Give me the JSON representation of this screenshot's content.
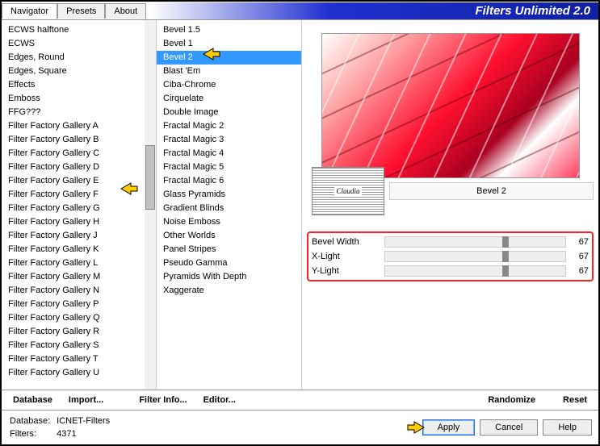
{
  "title": "Filters Unlimited 2.0",
  "tabs": [
    {
      "label": "Navigator",
      "active": true
    },
    {
      "label": "Presets",
      "active": false
    },
    {
      "label": "About",
      "active": false
    }
  ],
  "categories": [
    "ECWS halftone",
    "ECWS",
    "Edges, Round",
    "Edges, Square",
    "Effects",
    "Emboss",
    "FFG???",
    "Filter Factory Gallery A",
    "Filter Factory Gallery B",
    "Filter Factory Gallery C",
    "Filter Factory Gallery D",
    "Filter Factory Gallery E",
    "Filter Factory Gallery F",
    "Filter Factory Gallery G",
    "Filter Factory Gallery H",
    "Filter Factory Gallery J",
    "Filter Factory Gallery K",
    "Filter Factory Gallery L",
    "Filter Factory Gallery M",
    "Filter Factory Gallery N",
    "Filter Factory Gallery P",
    "Filter Factory Gallery Q",
    "Filter Factory Gallery R",
    "Filter Factory Gallery S",
    "Filter Factory Gallery T",
    "Filter Factory Gallery U"
  ],
  "categories_highlight_index": 13,
  "filters": [
    "Bevel 1.5",
    "Bevel 1",
    "Bevel 2",
    "Blast 'Em",
    "Ciba-Chrome",
    "Cirquelate",
    "Double Image",
    "Fractal Magic 2",
    "Fractal Magic 3",
    "Fractal Magic 4",
    "Fractal Magic 5",
    "Fractal Magic 6",
    "Glass Pyramids",
    "Gradient Blinds",
    "Noise Emboss",
    "Other Worlds",
    "Panel Stripes",
    "Pseudo Gamma",
    "Pyramids With Depth",
    "Xaggerate"
  ],
  "filters_selected_index": 2,
  "section_title": "Bevel 2",
  "badge_text": "Claudia",
  "params": [
    {
      "label": "Bevel Width",
      "value": "67"
    },
    {
      "label": "X-Light",
      "value": "67"
    },
    {
      "label": "Y-Light",
      "value": "67"
    }
  ],
  "toolbar": {
    "database": "Database",
    "import": "Import...",
    "filter_info": "Filter Info...",
    "editor": "Editor...",
    "randomize": "Randomize",
    "reset": "Reset"
  },
  "status": {
    "db_label": "Database:",
    "db_value": "ICNET-Filters",
    "filters_label": "Filters:",
    "filters_value": "4371"
  },
  "buttons": {
    "apply": "Apply",
    "cancel": "Cancel",
    "help": "Help"
  }
}
